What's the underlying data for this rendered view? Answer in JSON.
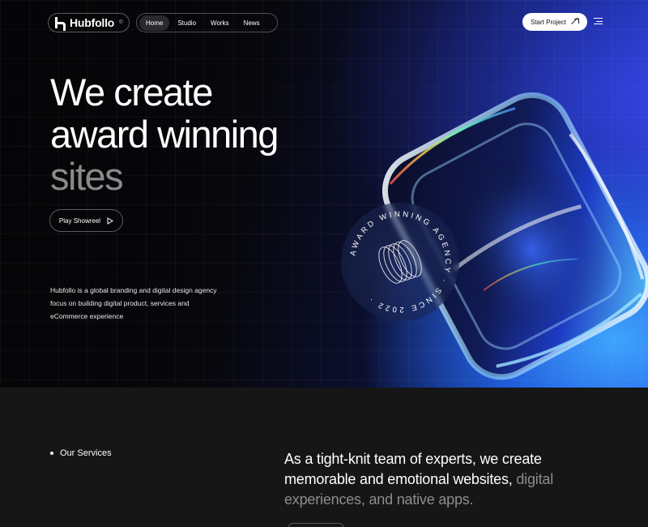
{
  "brand": {
    "name": "Hubfollo",
    "sup": "©"
  },
  "nav": {
    "items": [
      "Home",
      "Studio",
      "Works",
      "News"
    ],
    "active": "Home"
  },
  "header": {
    "cta_label": "Start Project"
  },
  "hero": {
    "headline_line1": "We create",
    "headline_line2": "award winning",
    "headline_line3": "sites",
    "showreel_label": "Play Showreel",
    "description": "Hubfollo is a global branding and digital design agency focus on building digital product, services and eCommerce experience"
  },
  "badge": {
    "text": "AWARD WINNING AGENCY · SINCE 2022 ·"
  },
  "services": {
    "label": "Our Services",
    "tagline_main": "As a tight-knit team of experts, we create memorable and emotional websites,",
    "tagline_muted": " digital experiences, and native apps."
  },
  "colors": {
    "accent_blue": "#2a46e6",
    "light_blue": "#40aaff",
    "bg_dark": "#050507",
    "section_bg": "#161616",
    "muted_text": "#8a8a8a"
  }
}
